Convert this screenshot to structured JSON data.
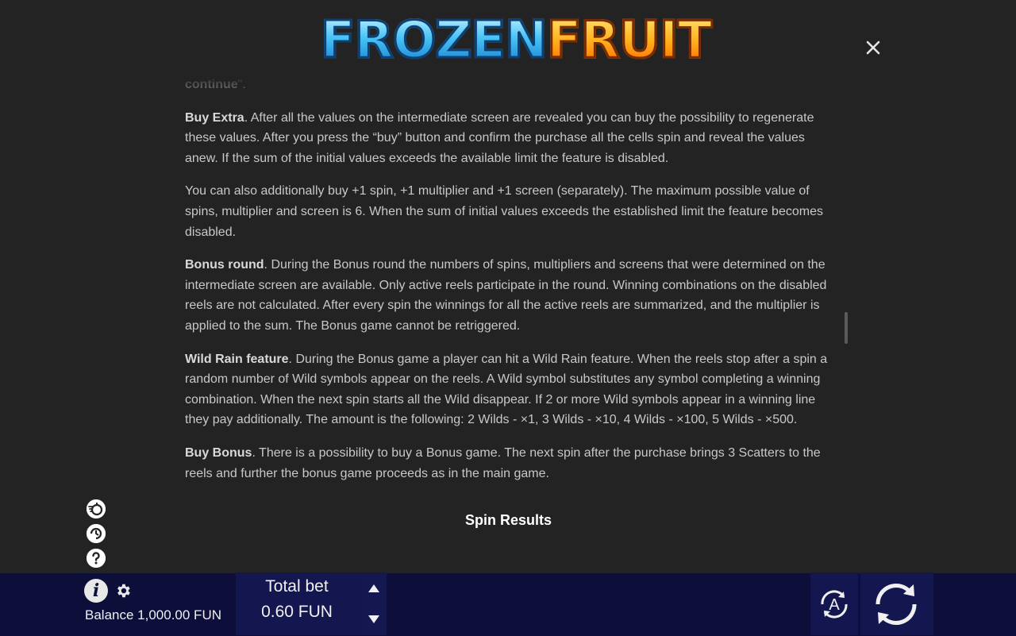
{
  "header": {
    "logo_word_1": "FROZEN",
    "logo_word_2": "FRUIT",
    "close_label": "×"
  },
  "rules": {
    "continue_tail": "continue",
    "continue_tail_suffix": "\".",
    "paragraphs": [
      {
        "title": "Buy Extra",
        "text": ". After all the values on the intermediate screen are revealed you can buy the possibility to regenerate these values. After you press the “buy” button and confirm the purchase all the cells spin and reveal the values anew. If the sum of the initial values exceeds the available limit the feature is disabled."
      },
      {
        "title": "",
        "text": "You can also additionally buy +1 spin, +1 multiplier and +1 screen (separately). The maximum possible value of spins, multiplier and screen is 6. When the sum of initial values exceeds the established limit the feature becomes disabled."
      },
      {
        "title": "Bonus round",
        "text": ". During the Bonus round the numbers of spins, multipliers and screens that were determined on the intermediate screen are available. Only active reels participate in the round. Winning combinations on the disabled reels are not calculated. After every spin the winnings for all the active reels are summarized, and the multiplier is applied to the sum. The Bonus game cannot be retriggered."
      },
      {
        "title": "Wild Rain feature",
        "text": ". During the Bonus game a player can hit a Wild Rain feature. When the reels stop after a spin a random number of Wild symbols appear on the reels. A Wild symbol substitutes any symbol completing a winning combination. When the next spin starts all the Wild disappear. If 2 or more Wild symbols appear in a winning line they pay additionally. The amount is the following: 2 Wilds - ×1, 3 Wilds - ×10, 4 Wilds - ×100, 5 Wilds - ×500."
      },
      {
        "title": "Buy Bonus",
        "text": ". There is a possibility to buy a Bonus game. The next spin after the purchase brings 3 Scatters to the reels and further the bonus game proceeds as in the main game."
      }
    ],
    "section_title": "Spin Results"
  },
  "bottom_bar": {
    "balance_label": "Balance 1,000.00 FUN",
    "total_bet_label": "Total bet",
    "total_bet_value": "0.60 FUN",
    "auto_label": "A"
  },
  "colors": {
    "background": "#232323",
    "bar": "#0d0e3a",
    "panel": "#141650",
    "text": "#c8c8c8"
  }
}
